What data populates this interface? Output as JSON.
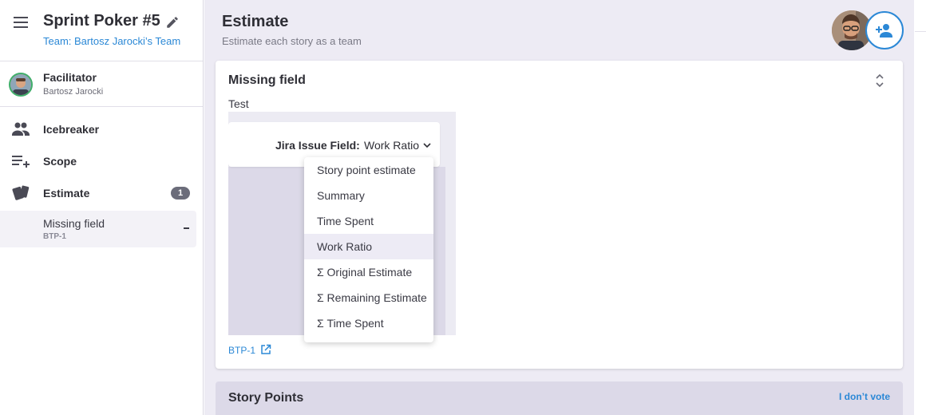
{
  "sidebar": {
    "title": "Sprint Poker #5",
    "team": "Team: Bartosz Jarocki’s Team",
    "facilitator": {
      "role": "Facilitator",
      "name": "Bartosz Jarocki"
    },
    "nav": [
      {
        "label": "Icebreaker",
        "icon": "group-icon"
      },
      {
        "label": "Scope",
        "icon": "playlist-add-icon"
      },
      {
        "label": "Estimate",
        "icon": "cards-icon",
        "badge": "1"
      }
    ],
    "sub_item": {
      "label": "Missing field",
      "key": "BTP-1"
    }
  },
  "header": {
    "title": "Estimate",
    "subtitle": "Estimate each story as a team"
  },
  "card": {
    "title": "Missing field",
    "description": "Test",
    "field_label": "Jira Issue Field:",
    "field_value": "Work Ratio",
    "issue_key": "BTP-1"
  },
  "dropdown": {
    "options": [
      "Story point estimate",
      "Summary",
      "Time Spent",
      "Work Ratio",
      "Σ Original Estimate",
      "Σ Remaining Estimate",
      "Σ Time Spent"
    ],
    "selected": "Work Ratio"
  },
  "story_points": {
    "title": "Story Points",
    "no_vote": "I don’t vote"
  },
  "colors": {
    "accent": "#2b88d6",
    "background": "#edebf4",
    "panel": "#dcd9e8",
    "badge": "#6b6c7a",
    "facilitator_ring": "#3fae6a"
  }
}
